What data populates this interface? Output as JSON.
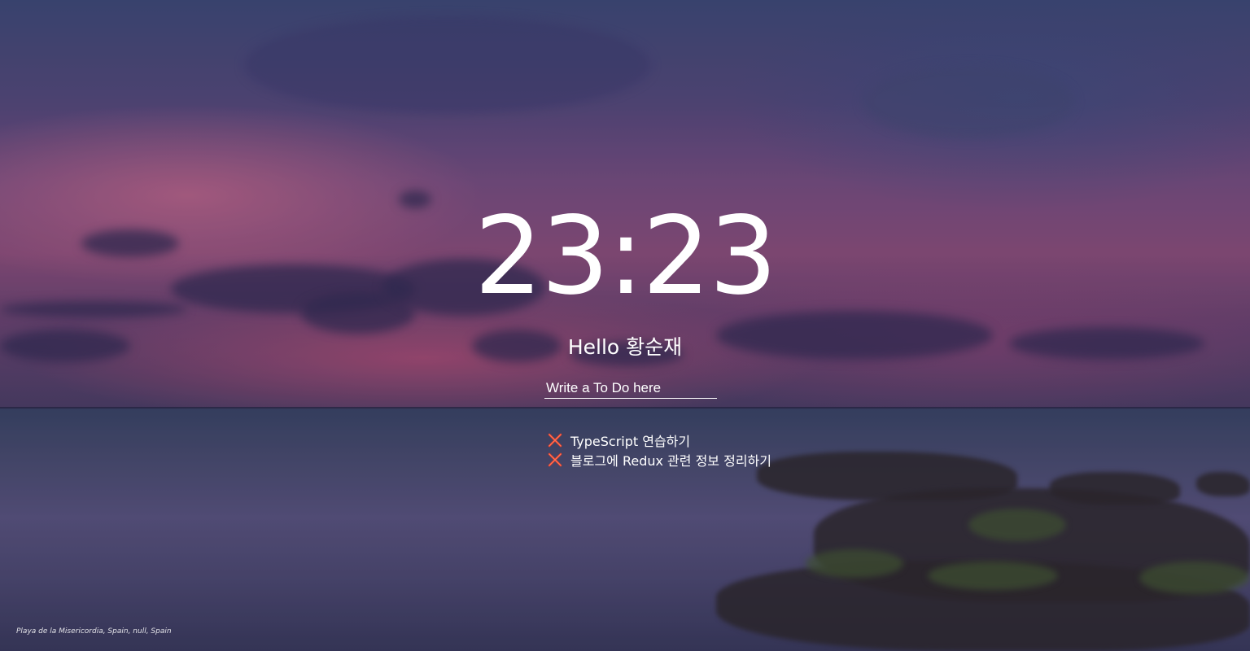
{
  "clock": {
    "time": "23:23"
  },
  "greeting": {
    "text": "Hello 황순재"
  },
  "todo_form": {
    "placeholder": "Write a To Do here",
    "value": ""
  },
  "todos": [
    {
      "icon": "close-x-icon",
      "text": "TypeScript 연습하기"
    },
    {
      "icon": "close-x-icon",
      "text": "블로그에 Redux 관련 정보 정리하기"
    }
  ],
  "background": {
    "location_caption": "Playa de la Misericordia, Spain, null, Spain"
  },
  "colors": {
    "text": "#ffffff",
    "delete_icon": "#e8402a"
  }
}
